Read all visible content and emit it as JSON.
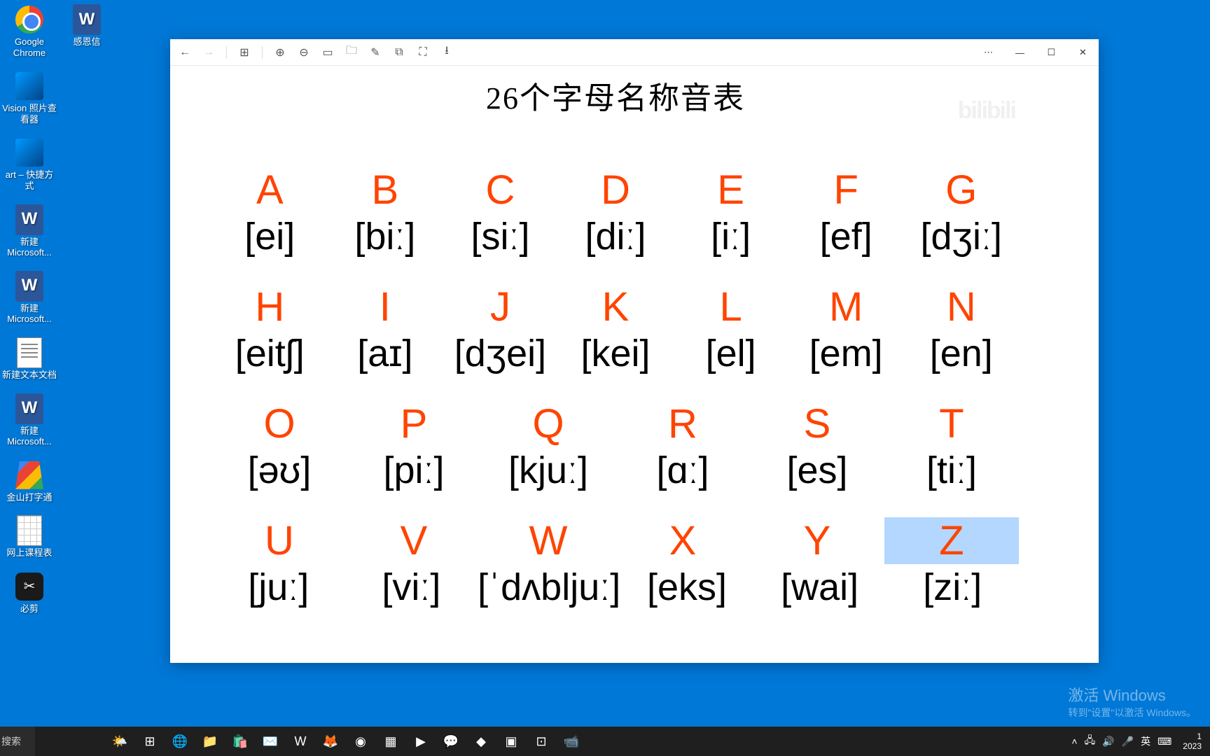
{
  "desktop": {
    "icons": [
      {
        "name": "chrome-icon",
        "label": "Google Chrome",
        "type": "chrome"
      },
      {
        "name": "vision-icon",
        "label": "Vision 照片查看器",
        "type": "app"
      },
      {
        "name": "shortcut-icon",
        "label": "art – 快捷方式",
        "type": "app"
      },
      {
        "name": "word-doc-1",
        "label": "新建 Microsoft...",
        "type": "word"
      },
      {
        "name": "word-doc-2",
        "label": "新建 Microsoft...",
        "type": "word"
      },
      {
        "name": "text-doc",
        "label": "新建文本文档",
        "type": "txt"
      },
      {
        "name": "word-doc-3",
        "label": "新建 Microsoft...",
        "type": "word"
      },
      {
        "name": "typing-app",
        "label": "金山打字通",
        "type": "gstore"
      },
      {
        "name": "schedule",
        "label": "网上课程表",
        "type": "xls"
      },
      {
        "name": "bixu-app",
        "label": "必剪",
        "type": "black"
      }
    ],
    "icons_col2": [
      {
        "name": "word-doc-letter",
        "label": "感恩信",
        "type": "word"
      }
    ]
  },
  "viewer": {
    "toolbar": [
      {
        "name": "back-icon",
        "glyph": "←",
        "interactable": true
      },
      {
        "name": "forward-icon",
        "glyph": "→",
        "interactable": false
      },
      {
        "name": "gallery-icon",
        "glyph": "⊞",
        "interactable": true
      },
      {
        "name": "zoom-in-icon",
        "glyph": "⊕",
        "interactable": true
      },
      {
        "name": "zoom-out-icon",
        "glyph": "⊖",
        "interactable": true
      },
      {
        "name": "fit-icon",
        "glyph": "▭",
        "interactable": true
      },
      {
        "name": "folder-icon",
        "glyph": "🗀",
        "interactable": true
      },
      {
        "name": "edit-icon",
        "glyph": "✎",
        "interactable": true
      },
      {
        "name": "copy-icon",
        "glyph": "⧉",
        "interactable": true
      },
      {
        "name": "fullscreen-icon",
        "glyph": "⛶",
        "interactable": true
      },
      {
        "name": "download-icon",
        "glyph": "⭳",
        "interactable": true
      }
    ],
    "more_glyph": "⋯",
    "min_glyph": "—",
    "max_glyph": "☐",
    "close_glyph": "✕"
  },
  "document": {
    "title": "26个字母名称音表",
    "watermark": "bilibili",
    "rows": [
      {
        "letters": [
          "A",
          "B",
          "C",
          "D",
          "E",
          "F",
          "G"
        ],
        "phonetics": [
          "[ei]",
          "[biː]",
          "[siː]",
          "[diː]",
          "[iː]",
          "[ef]",
          "[dʒiː]"
        ]
      },
      {
        "letters": [
          "H",
          "I",
          "J",
          "K",
          "L",
          "M",
          "N"
        ],
        "phonetics": [
          "[eitʃ]",
          "[aɪ]",
          "[dʒei]",
          "[kei]",
          "[el]",
          "[em]",
          "[en]"
        ]
      },
      {
        "letters": [
          "O",
          "P",
          "Q",
          "R",
          "S",
          "T"
        ],
        "phonetics": [
          "[əʊ]",
          "[piː]",
          "[kjuː]",
          "[ɑː]",
          "[es]",
          "[tiː]"
        ]
      },
      {
        "letters": [
          "U",
          "V",
          "W",
          "X",
          "Y",
          "Z"
        ],
        "phonetics": [
          "[juː]",
          "[viː]",
          "[ˈdʌbljuː]",
          "[eks]",
          "[wai]",
          "[ziː]"
        ]
      }
    ],
    "selected": {
      "row": 3,
      "col": 5
    }
  },
  "taskbar": {
    "search_label": "搜索",
    "items": [
      {
        "name": "weather-icon",
        "glyph": "🌤️"
      },
      {
        "name": "taskview-icon",
        "glyph": "⊞"
      },
      {
        "name": "edge-icon",
        "glyph": "🌐"
      },
      {
        "name": "explorer-icon",
        "glyph": "📁"
      },
      {
        "name": "store-icon",
        "glyph": "🛍️"
      },
      {
        "name": "mail-icon",
        "glyph": "✉️"
      },
      {
        "name": "word-icon",
        "glyph": "W"
      },
      {
        "name": "firefox-icon",
        "glyph": "🦊"
      },
      {
        "name": "chrome-task-icon",
        "glyph": "◉"
      },
      {
        "name": "app-1-icon",
        "glyph": "▦"
      },
      {
        "name": "app-2-icon",
        "glyph": "▶"
      },
      {
        "name": "wechat-icon",
        "glyph": "💬"
      },
      {
        "name": "app-3-icon",
        "glyph": "◆"
      },
      {
        "name": "app-4-icon",
        "glyph": "▣"
      },
      {
        "name": "app-5-icon",
        "glyph": "⊡"
      },
      {
        "name": "app-6-icon",
        "glyph": "📹"
      }
    ],
    "tray": {
      "chevron": "˄",
      "ime": "英",
      "keyboard": "⌨",
      "sound": "🔊",
      "network": "🖧",
      "mic": "🎤",
      "time": "1",
      "date": "2023"
    }
  },
  "activate": {
    "title": "激活 Windows",
    "subtitle": "转到\"设置\"以激活 Windows。"
  }
}
